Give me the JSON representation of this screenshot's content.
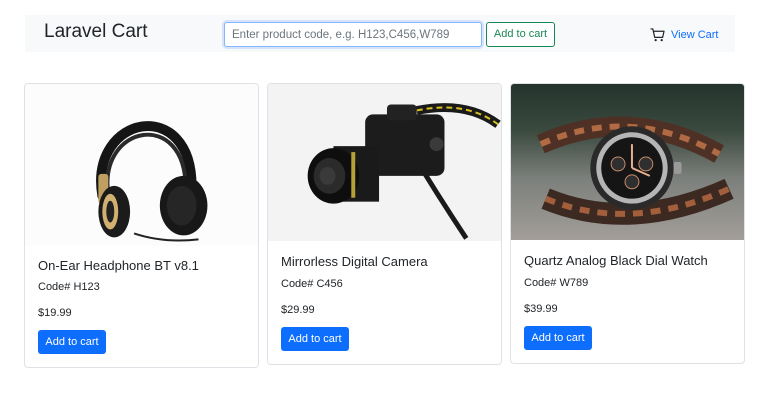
{
  "navbar": {
    "brand": "Laravel Cart",
    "search_placeholder": "Enter product code, e.g. H123,C456,W789",
    "search_value": "",
    "add_button": "Add to cart",
    "view_cart": "View Cart"
  },
  "products": [
    {
      "title": "On-Ear Headphone BT v8.1",
      "code": "Code# H123",
      "price": "$19.99",
      "button": "Add to cart"
    },
    {
      "title": "Mirrorless Digital Camera",
      "code": "Code# C456",
      "price": "$29.99",
      "button": "Add to cart"
    },
    {
      "title": "Quartz Analog Black Dial Watch",
      "code": "Code# W789",
      "price": "$39.99",
      "button": "Add to cart"
    }
  ],
  "colors": {
    "primary": "#0d6efd",
    "success": "#198754",
    "navbar_bg": "#f8f9fa"
  },
  "icons": {
    "cart": "cart-icon"
  }
}
